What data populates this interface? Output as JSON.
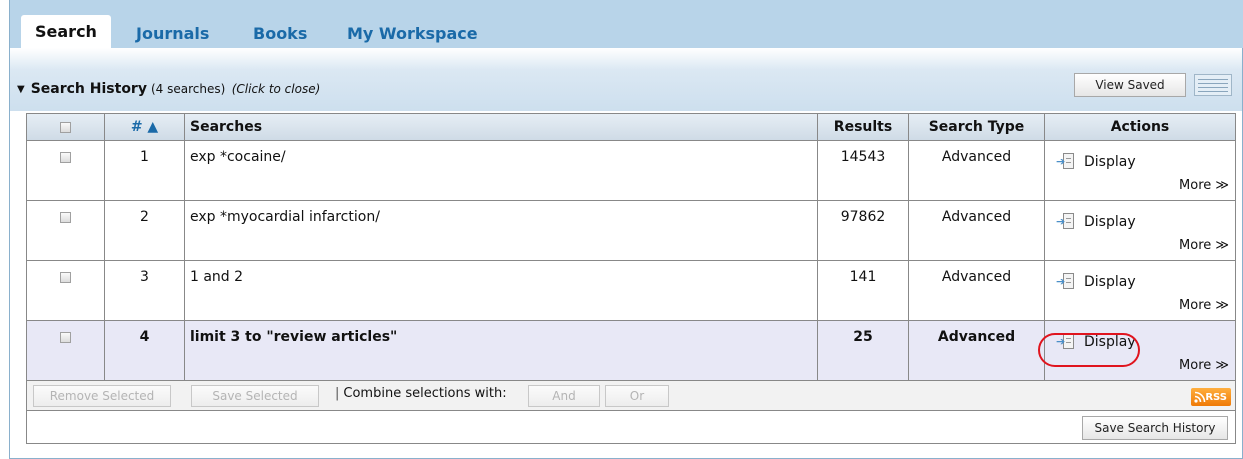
{
  "tabs": [
    {
      "label": "Search"
    },
    {
      "label": "Journals"
    },
    {
      "label": "Books"
    },
    {
      "label": "My Workspace"
    }
  ],
  "search_history": {
    "title": "Search History",
    "count_text": "(4 searches)",
    "close_hint": "(Click to close)",
    "view_saved_label": "View Saved"
  },
  "table": {
    "headers": {
      "number": "# ▲",
      "searches": "Searches",
      "results": "Results",
      "search_type": "Search Type",
      "actions": "Actions"
    },
    "rows": [
      {
        "num": "1",
        "query": "exp *cocaine/",
        "results": "14543",
        "type": "Advanced",
        "display": "Display",
        "more": "More ≫"
      },
      {
        "num": "2",
        "query": "exp *myocardial infarction/",
        "results": "97862",
        "type": "Advanced",
        "display": "Display",
        "more": "More ≫"
      },
      {
        "num": "3",
        "query": "1 and 2",
        "results": "141",
        "type": "Advanced",
        "display": "Display",
        "more": "More ≫"
      },
      {
        "num": "4",
        "query": "limit 3 to \"review articles\"",
        "results": "25",
        "type": "Advanced",
        "display": "Display",
        "more": "More ≫"
      }
    ]
  },
  "actions": {
    "remove_selected": "Remove Selected",
    "save_selected": "Save Selected",
    "combine_label": "Combine selections with:",
    "and": "And",
    "or": "Or",
    "rss": "RSS",
    "save_history": "Save Search History"
  },
  "colors": {
    "tab_link": "#1a6aa8",
    "highlight_row": "#e8e8f6",
    "annotation_ring": "#e0141e",
    "rss_orange": "#ef7a06"
  }
}
